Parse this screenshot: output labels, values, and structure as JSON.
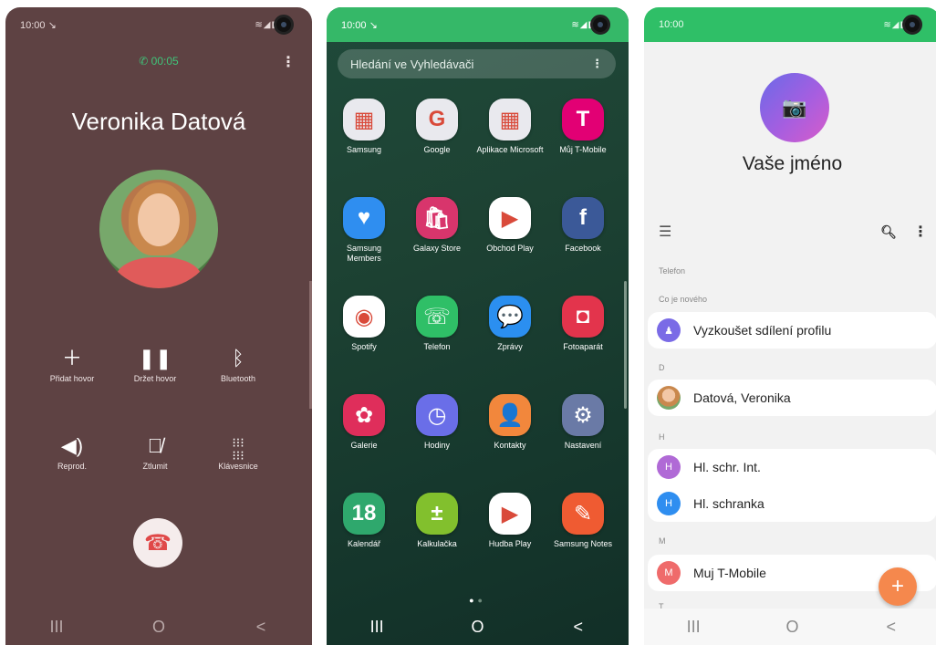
{
  "phones": [
    {
      "status": {
        "time": "10:00 ↘",
        "icons": "≋◢▮"
      },
      "call": {
        "timer": "✆ 00:05",
        "caller": "Veronika Datová",
        "buttons": [
          {
            "label": "Přidat hovor",
            "icon": "plus-icon"
          },
          {
            "label": "Držet hovor",
            "icon": "pause-icon"
          },
          {
            "label": "Bluetooth",
            "icon": "bluetooth-icon"
          },
          {
            "label": "Reprod.",
            "icon": "speaker-icon"
          },
          {
            "label": "Ztlumit",
            "icon": "mute-mic-icon"
          },
          {
            "label": "Klávesnice",
            "icon": "keypad-icon"
          }
        ],
        "end_color": "#e04848"
      }
    },
    {
      "status": {
        "time": "10:00 ↘",
        "icons": "≋◢▮"
      },
      "search_placeholder": "Hledání ve Vyhledávači",
      "apps": [
        {
          "name": "Samsung",
          "color": "#e9e9ee"
        },
        {
          "name": "Google",
          "color": "#e9e9ee"
        },
        {
          "name": "Aplikace Microsoft",
          "color": "#e9e9ee"
        },
        {
          "name": "Můj T-Mobile",
          "color": "#e20074"
        },
        {
          "name": "Samsung Members",
          "color": "#2f8ef0"
        },
        {
          "name": "Galaxy Store",
          "color": "#d8356c"
        },
        {
          "name": "Obchod Play",
          "color": "#ffffff"
        },
        {
          "name": "Facebook",
          "color": "#3b5998"
        },
        {
          "name": "Spotify",
          "color": "#ffffff"
        },
        {
          "name": "Telefon",
          "color": "#2fbf67"
        },
        {
          "name": "Zprávy",
          "color": "#2b8ff0"
        },
        {
          "name": "Fotoaparát",
          "color": "#e3344c"
        },
        {
          "name": "Galerie",
          "color": "#df2e5b"
        },
        {
          "name": "Hodiny",
          "color": "#6a6ee8"
        },
        {
          "name": "Kontakty",
          "color": "#f2873c"
        },
        {
          "name": "Nastavení",
          "color": "#6a7aa6"
        },
        {
          "name": "Kalendář",
          "color": "#2fa86d"
        },
        {
          "name": "Kalkulačka",
          "color": "#82c02d"
        },
        {
          "name": "Hudba Play",
          "color": "#ffffff"
        },
        {
          "name": "Samsung Notes",
          "color": "#ef5b32"
        }
      ]
    },
    {
      "status": {
        "time": "10:00",
        "icons": "≋◢▮"
      },
      "profile_name": "Vaše jméno",
      "sections": {
        "telefon": "Telefon",
        "new": "Co je nového",
        "d": "D",
        "h": "H",
        "m": "M",
        "t": "T"
      },
      "contacts": [
        {
          "name": "Vyzkoušet sdílení profilu",
          "initial": "",
          "color": "#7a6be6"
        },
        {
          "name": "Datová, Veronika",
          "initial": "",
          "color": "#e2a56a"
        },
        {
          "name": "Hl. schr. Int.",
          "initial": "H",
          "color": "#b06ad6"
        },
        {
          "name": "Hl. schranka",
          "initial": "H",
          "color": "#2f8ef0"
        },
        {
          "name": "Muj T-Mobile",
          "initial": "M",
          "color": "#ef6b6b"
        }
      ]
    }
  ],
  "nav": {
    "recents": "III",
    "home": "O",
    "back": "<"
  }
}
